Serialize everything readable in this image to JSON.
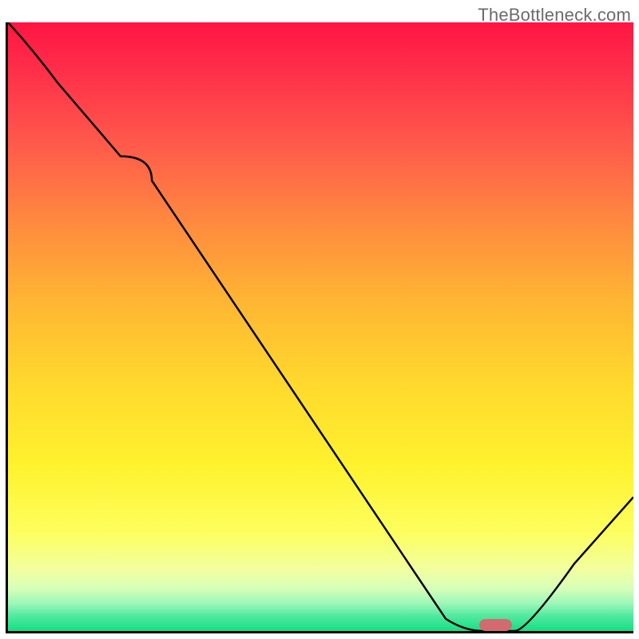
{
  "watermark": "TheBottleneck.com",
  "chart_data": {
    "type": "line",
    "title": "",
    "xlabel": "",
    "ylabel": "",
    "xlim": [
      0,
      100
    ],
    "ylim": [
      0,
      100
    ],
    "grid": false,
    "legend": false,
    "background_gradient_stops": [
      {
        "pos": 0,
        "color": "#ff1543"
      },
      {
        "pos": 0.08,
        "color": "#ff2f4a"
      },
      {
        "pos": 0.2,
        "color": "#ff5a4b"
      },
      {
        "pos": 0.33,
        "color": "#ff8a3f"
      },
      {
        "pos": 0.46,
        "color": "#ffb633"
      },
      {
        "pos": 0.6,
        "color": "#ffda2d"
      },
      {
        "pos": 0.73,
        "color": "#fff22e"
      },
      {
        "pos": 0.84,
        "color": "#fdff60"
      },
      {
        "pos": 0.9,
        "color": "#f1ffa0"
      },
      {
        "pos": 0.93,
        "color": "#d7ffb9"
      },
      {
        "pos": 0.955,
        "color": "#9cf7b8"
      },
      {
        "pos": 0.975,
        "color": "#52e9a0"
      },
      {
        "pos": 1.0,
        "color": "#14df83"
      }
    ],
    "series": [
      {
        "name": "bottleneck-curve",
        "color": "#000000",
        "x": [
          0,
          8,
          18,
          23,
          70,
          76,
          81,
          100
        ],
        "y": [
          100,
          90,
          78,
          74,
          2,
          0,
          0,
          22
        ]
      }
    ],
    "marker": {
      "name": "optimal-point",
      "color": "#d36a6f",
      "x_center": 78,
      "y_center": 0,
      "width_pct": 5.3,
      "height_pct": 2
    }
  }
}
